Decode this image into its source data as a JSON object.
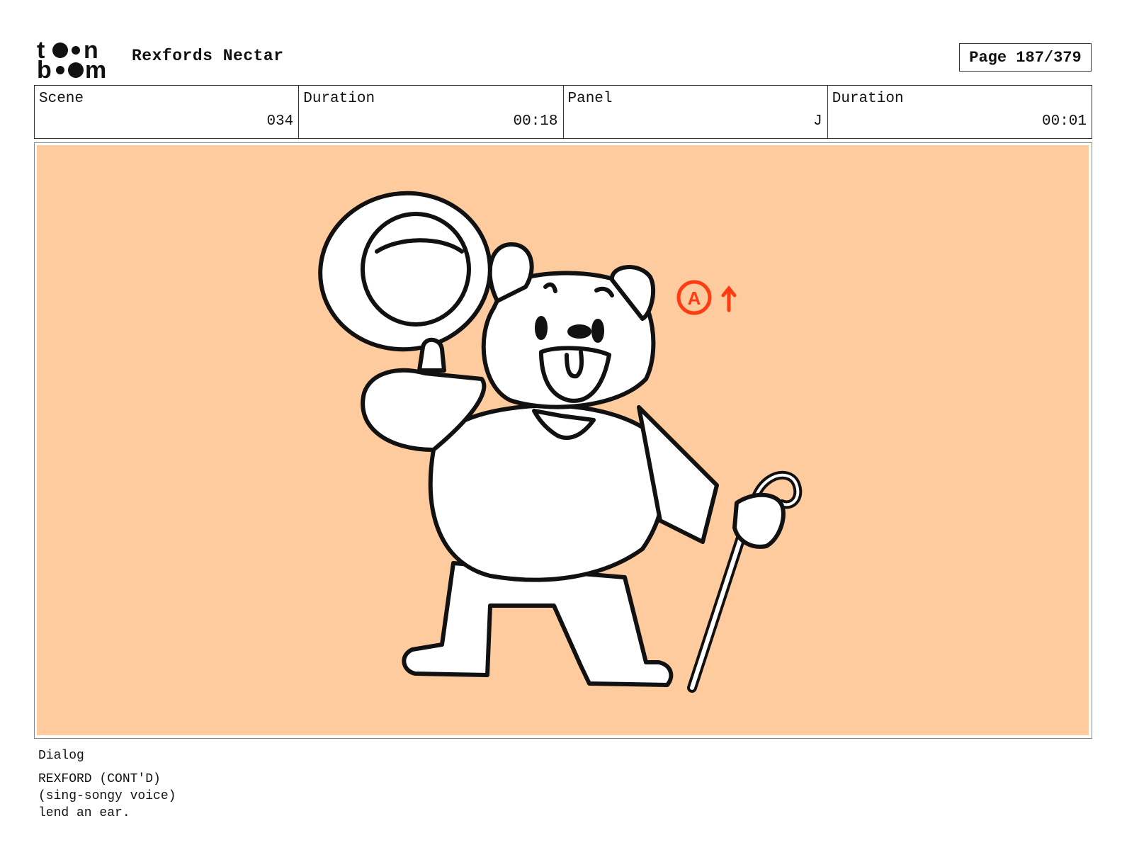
{
  "header": {
    "logo_text": "toonboom",
    "project_title": "Rexfords Nectar",
    "page_indicator": "Page 187/379"
  },
  "info": {
    "scene_label": "Scene",
    "scene_value": "034",
    "scene_duration_label": "Duration",
    "scene_duration_value": "00:18",
    "panel_label": "Panel",
    "panel_value": "J",
    "panel_duration_label": "Duration",
    "panel_duration_value": "00:01"
  },
  "panel": {
    "background_color": "#fdcb9e",
    "annotation_color": "#ff3b12",
    "annotation_text": "A"
  },
  "dialog": {
    "label": "Dialog",
    "lines": [
      "REXFORD (CONT'D)",
      "(sing-songy voice)",
      "lend an ear."
    ]
  }
}
